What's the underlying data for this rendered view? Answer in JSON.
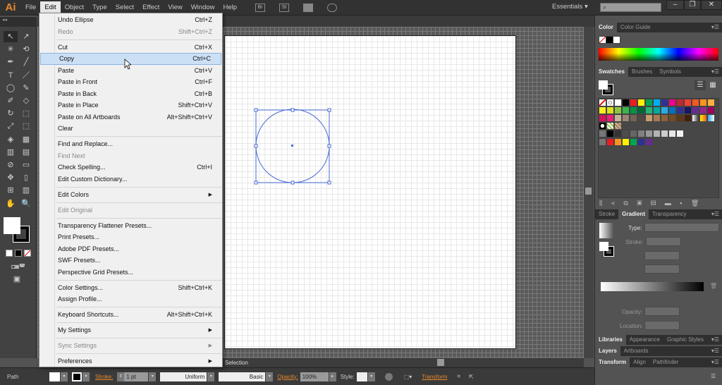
{
  "app": {
    "logo": "Ai",
    "menus": [
      "File",
      "Edit",
      "Object",
      "Type",
      "Select",
      "Effect",
      "View",
      "Window",
      "Help"
    ],
    "active_menu": "Edit",
    "topbar_icons": [
      "bridge-icon",
      "stock-icon",
      "arrange-documents-icon",
      "gpu-performance-icon"
    ],
    "bridge_label": "Br",
    "stock_label": "St",
    "workspace": "Essentials",
    "search_placeholder": "",
    "window_buttons": [
      "minimize",
      "restore",
      "close"
    ]
  },
  "edit_menu": [
    {
      "label": "Undo Ellipse",
      "shortcut": "Ctrl+Z"
    },
    {
      "label": "Redo",
      "shortcut": "Shift+Ctrl+Z",
      "disabled": true
    },
    {
      "sep": true
    },
    {
      "label": "Cut",
      "shortcut": "Ctrl+X"
    },
    {
      "label": "Copy",
      "shortcut": "Ctrl+C",
      "highlighted": true
    },
    {
      "label": "Paste",
      "shortcut": "Ctrl+V"
    },
    {
      "label": "Paste in Front",
      "shortcut": "Ctrl+F"
    },
    {
      "label": "Paste in Back",
      "shortcut": "Ctrl+B"
    },
    {
      "label": "Paste in Place",
      "shortcut": "Shift+Ctrl+V"
    },
    {
      "label": "Paste on All Artboards",
      "shortcut": "Alt+Shift+Ctrl+V"
    },
    {
      "label": "Clear",
      "shortcut": ""
    },
    {
      "sep": true
    },
    {
      "label": "Find and Replace...",
      "shortcut": ""
    },
    {
      "label": "Find Next",
      "shortcut": "",
      "disabled": true
    },
    {
      "label": "Check Spelling...",
      "shortcut": "Ctrl+I"
    },
    {
      "label": "Edit Custom Dictionary...",
      "shortcut": ""
    },
    {
      "sep": true
    },
    {
      "label": "Edit Colors",
      "submenu": true
    },
    {
      "sep": true
    },
    {
      "label": "Edit Original",
      "disabled": true
    },
    {
      "sep": true
    },
    {
      "label": "Transparency Flattener Presets..."
    },
    {
      "label": "Print Presets..."
    },
    {
      "label": "Adobe PDF Presets..."
    },
    {
      "label": "SWF Presets..."
    },
    {
      "label": "Perspective Grid Presets..."
    },
    {
      "sep": true
    },
    {
      "label": "Color Settings...",
      "shortcut": "Shift+Ctrl+K"
    },
    {
      "label": "Assign Profile..."
    },
    {
      "sep": true
    },
    {
      "label": "Keyboard Shortcuts...",
      "shortcut": "Alt+Shift+Ctrl+K"
    },
    {
      "sep": true
    },
    {
      "label": "My Settings",
      "submenu": true
    },
    {
      "sep": true
    },
    {
      "label": "Sync Settings",
      "submenu": true,
      "disabled": true
    },
    {
      "sep": true
    },
    {
      "label": "Preferences",
      "submenu": true
    }
  ],
  "status": {
    "tool": "Selection"
  },
  "control_bar": {
    "object": "Path",
    "stroke_label": "Stroke:",
    "stroke_weight": "1 pt",
    "profile": "Uniform",
    "brush": "Basic",
    "opacity_label": "Opacity:",
    "opacity": "100%",
    "style_label": "Style:",
    "transform_label": "Transform"
  },
  "panels": {
    "color_tabs": [
      "Color",
      "Color Guide"
    ],
    "swatch_tabs": [
      "Swatches",
      "Brushes",
      "Symbols"
    ],
    "gradient_tabs": [
      "Stroke",
      "Gradient",
      "Transparency"
    ],
    "gradient": {
      "type_label": "Type:",
      "stroke_label": "Stroke:",
      "opacity_label": "Opacity:",
      "location_label": "Location:"
    },
    "lib_tabs": [
      "Libraries",
      "Appearance",
      "Graphic Styles"
    ],
    "layer_tabs": [
      "Layers",
      "Artboards"
    ],
    "transform_tabs": [
      "Transform",
      "Align",
      "Pathfinder"
    ]
  },
  "swatches": [
    [
      "none",
      "registration",
      "#ffffff",
      "#000000",
      "#ed1c24",
      "#fff200",
      "#00a651",
      "#00aeef",
      "#2e3192",
      "#ec008c",
      "#c1272d",
      "#ef4136",
      "#f15a24",
      "#f7931e",
      "#fbb040"
    ],
    [
      "#fcee21",
      "#d9e021",
      "#8cc63f",
      "#39b54a",
      "#009245",
      "#006837",
      "#22b573",
      "#00a99d",
      "#29abe2",
      "#0071bc",
      "#2e3192",
      "#1b1464",
      "#662d91",
      "#93278f",
      "#9e005d"
    ],
    [
      "#d4145a",
      "#ed1e79",
      "#c7b299",
      "#998675",
      "#736357",
      "#534741",
      "#c69c6d",
      "#a67c52",
      "#8c6239",
      "#754c24",
      "#603813",
      "#42210b",
      "#gradbw",
      "#gradyo",
      "#gradblue"
    ],
    [
      "pattern1",
      "pattern2",
      "pattern3"
    ],
    [
      "folder",
      "#000000",
      "#333333",
      "#4d4d4d",
      "#666666",
      "#808080",
      "#999999",
      "#b3b3b3",
      "#cccccc",
      "#e6e6e6",
      "#f2f2f2"
    ],
    [
      "folder",
      "#ed1c24",
      "#f7931e",
      "#fff200",
      "#00a651",
      "#2e3192",
      "#662d91"
    ]
  ],
  "colors": {
    "accent": "#e8892d",
    "selection": "#4a6cd4",
    "menu_highlight": "#cce0f5"
  }
}
